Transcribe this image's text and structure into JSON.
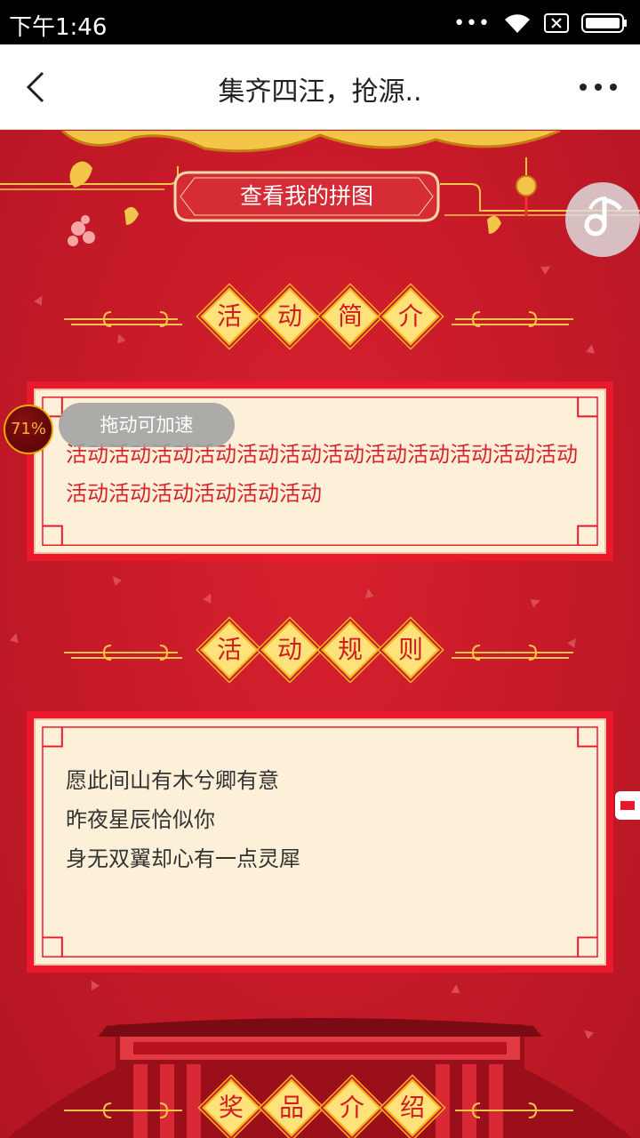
{
  "status_bar": {
    "time": "下午1:46"
  },
  "nav": {
    "title": "集齐四汪，抢源.."
  },
  "top": {
    "view_puzzle_label": "查看我的拼图"
  },
  "sections": {
    "intro": {
      "heading_chars": [
        "活",
        "动",
        "简",
        "介"
      ],
      "text": "活动活动活动活动活动活动活动活动活动活动活动活动活动活动活动活动活动活动"
    },
    "rules": {
      "heading_chars": [
        "活",
        "动",
        "规",
        "则"
      ],
      "lines": [
        "愿此间山有木兮卿有意",
        "昨夜星辰恰似你",
        "身无双翼却心有一点灵犀"
      ]
    },
    "prizes": {
      "heading_chars": [
        "奖",
        "品",
        "介",
        "绍"
      ]
    }
  },
  "speed_widget": {
    "percent": "71%",
    "tip": "拖动可加速"
  },
  "colors": {
    "page_red": "#c81c2a",
    "panel_red": "#e9192b",
    "gold": "#ffe27a",
    "cream": "#fdf0d9"
  }
}
